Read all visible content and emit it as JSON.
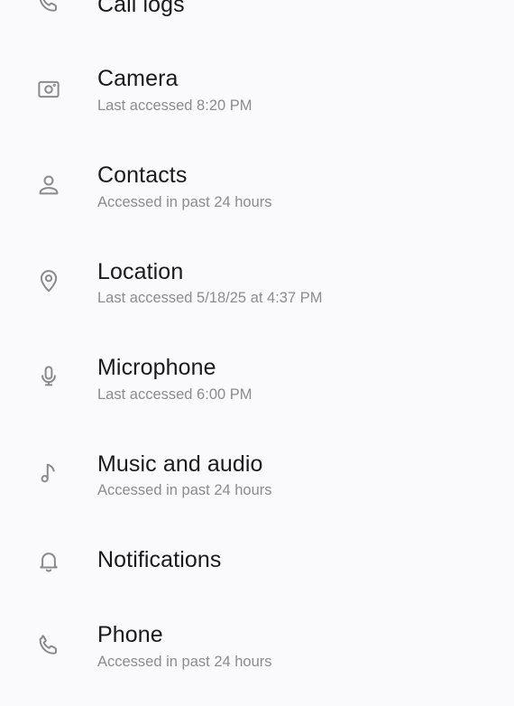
{
  "permissions": [
    {
      "label": "Call logs",
      "subtitle": "",
      "icon": "phone-icon"
    },
    {
      "label": "Camera",
      "subtitle": "Last accessed 8:20 PM",
      "icon": "camera-icon"
    },
    {
      "label": "Contacts",
      "subtitle": "Accessed in past 24 hours",
      "icon": "person-icon"
    },
    {
      "label": "Location",
      "subtitle": "Last accessed 5/18/25 at 4:37 PM",
      "icon": "location-pin-icon"
    },
    {
      "label": "Microphone",
      "subtitle": "Last accessed 6:00 PM",
      "icon": "microphone-icon"
    },
    {
      "label": "Music and audio",
      "subtitle": "Accessed in past 24 hours",
      "icon": "music-note-icon"
    },
    {
      "label": "Notifications",
      "subtitle": "",
      "icon": "bell-icon"
    },
    {
      "label": "Phone",
      "subtitle": "Accessed in past 24 hours",
      "icon": "phone-icon"
    }
  ],
  "colors": {
    "background": "#fafafc",
    "title_text": "#1a1a1c",
    "subtitle_text": "#8b8b90",
    "icon_stroke": "#8a8a8e"
  }
}
